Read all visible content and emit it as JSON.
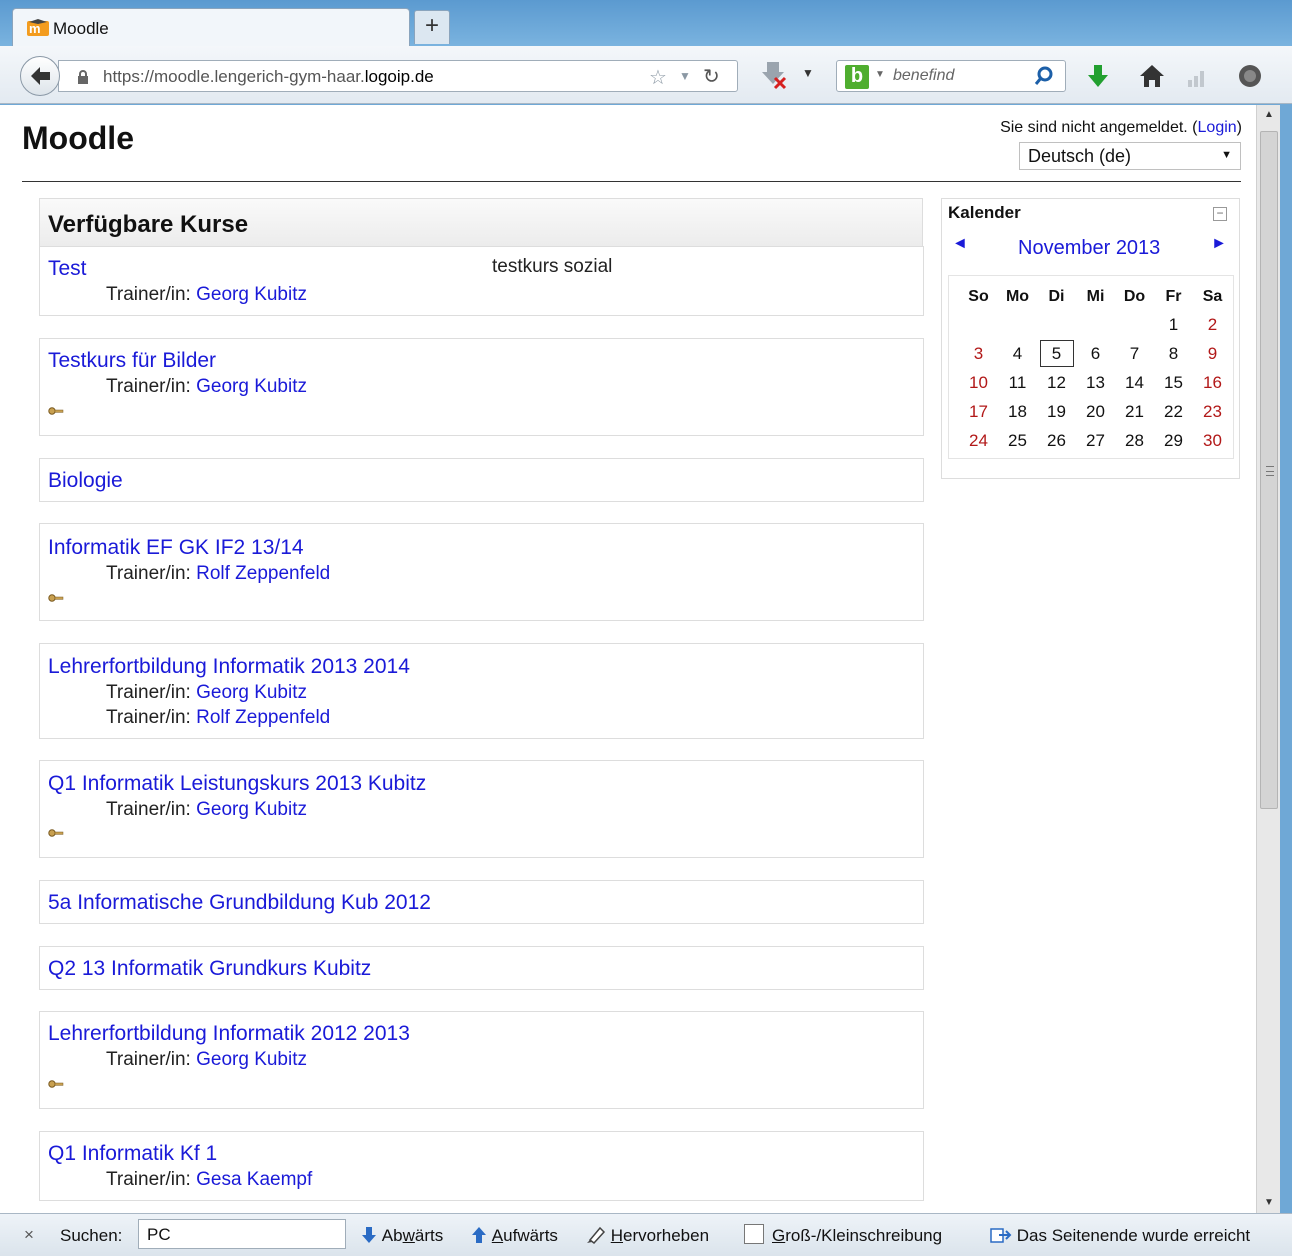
{
  "browser": {
    "tab_title": "Moodle",
    "new_tab": "+",
    "url_prefix": "https://moodle.lengerich-gym-haar.",
    "url_host": "logoip.de",
    "search_placeholder": "benefind"
  },
  "header": {
    "site_name": "Moodle",
    "login_text": "Sie sind nicht angemeldet. (",
    "login_link": "Login",
    "login_close": ")",
    "language": "Deutsch (de)"
  },
  "courses": {
    "heading": "Verfügbare Kurse",
    "trainer_label": "Trainer/in:",
    "items": [
      {
        "name": "Test",
        "summary": "testkurs sozial",
        "teachers": [
          "Georg Kubitz"
        ]
      },
      {
        "name": "Testkurs für Bilder",
        "teachers": [
          "Georg Kubitz"
        ],
        "key": true
      },
      {
        "name": "Biologie",
        "teachers": []
      },
      {
        "name": "Informatik EF GK IF2 13/14",
        "teachers": [
          "Rolf Zeppenfeld"
        ],
        "key": true
      },
      {
        "name": "Lehrerfortbildung Informatik 2013 2014",
        "teachers": [
          "Georg Kubitz",
          "Rolf Zeppenfeld"
        ]
      },
      {
        "name": "Q1 Informatik Leistungskurs 2013 Kubitz",
        "teachers": [
          "Georg Kubitz"
        ],
        "key": true
      },
      {
        "name": "5a Informatische Grundbildung Kub 2012",
        "teachers": []
      },
      {
        "name": "Q2 13 Informatik Grundkurs Kubitz",
        "teachers": []
      },
      {
        "name": "Lehrerfortbildung Informatik 2012 2013",
        "teachers": [
          "Georg Kubitz"
        ],
        "key": true
      },
      {
        "name": "Q1 Informatik Kf 1",
        "teachers": [
          "Gesa Kaempf"
        ]
      }
    ]
  },
  "calendar": {
    "title": "Kalender",
    "collapse": "−",
    "prev": "◄",
    "next": "►",
    "month": "November 2013",
    "weekdays": [
      "So",
      "Mo",
      "Di",
      "Mi",
      "Do",
      "Fr",
      "Sa"
    ],
    "weeks": [
      [
        "",
        "",
        "",
        "",
        "",
        "1",
        "2"
      ],
      [
        "3",
        "4",
        "5",
        "6",
        "7",
        "8",
        "9"
      ],
      [
        "10",
        "11",
        "12",
        "13",
        "14",
        "15",
        "16"
      ],
      [
        "17",
        "18",
        "19",
        "20",
        "21",
        "22",
        "23"
      ],
      [
        "24",
        "25",
        "26",
        "27",
        "28",
        "29",
        "30"
      ]
    ],
    "today": "5",
    "weekend_color": "#b21818"
  },
  "findbar": {
    "close": "×",
    "label": "Suchen:",
    "value": "PC",
    "next_pre": "Ab",
    "next_acc": "w",
    "next_post": "ärts",
    "prev_acc": "A",
    "prev_post": "ufwärts",
    "highlight_acc": "H",
    "highlight_post": "ervorheben",
    "case_acc": "G",
    "case_post": "roß-/Kleinschreibung",
    "status": "Das Seitenende wurde erreicht"
  }
}
